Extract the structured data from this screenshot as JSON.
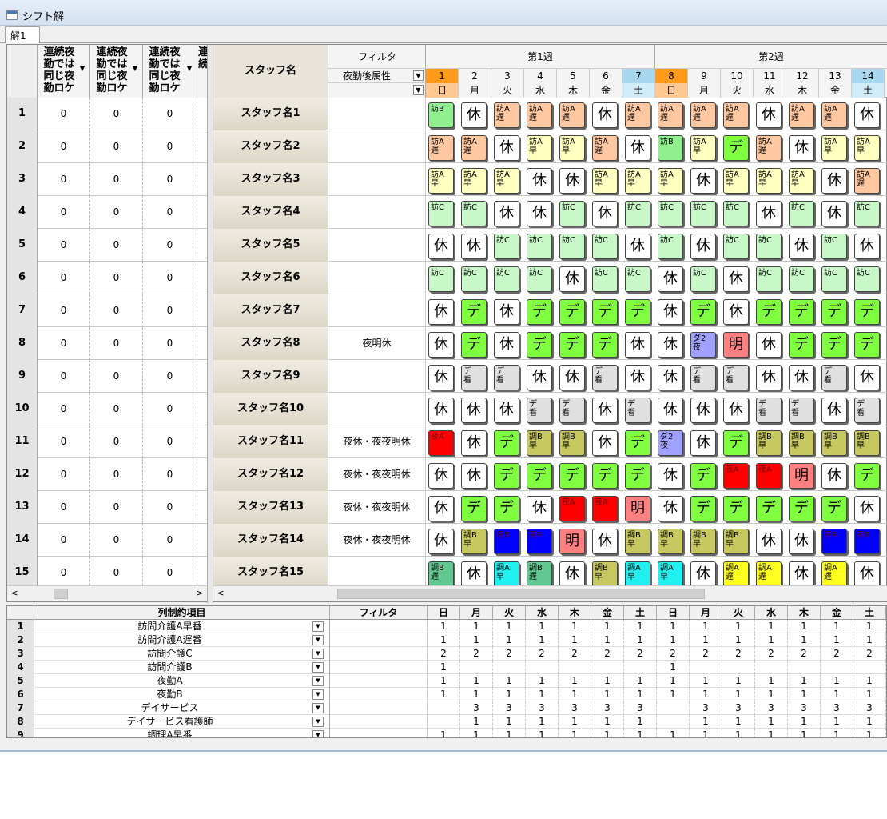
{
  "window": {
    "title": "シフト解",
    "tab": "解1"
  },
  "left_grid": {
    "headers": [
      "連続夜勤では同じ夜勤ロケ",
      "連続夜勤では同じ夜勤ロケ",
      "連続夜勤では同じ夜勤ロケ",
      "連続"
    ],
    "rows": [
      {
        "num": "1",
        "vals": [
          "0",
          "0",
          "0"
        ]
      },
      {
        "num": "2",
        "vals": [
          "0",
          "0",
          "0"
        ]
      },
      {
        "num": "3",
        "vals": [
          "0",
          "0",
          "0"
        ]
      },
      {
        "num": "4",
        "vals": [
          "0",
          "0",
          "0"
        ]
      },
      {
        "num": "5",
        "vals": [
          "0",
          "0",
          "0"
        ]
      },
      {
        "num": "6",
        "vals": [
          "0",
          "0",
          "0"
        ]
      },
      {
        "num": "7",
        "vals": [
          "0",
          "0",
          "0"
        ]
      },
      {
        "num": "8",
        "vals": [
          "0",
          "0",
          "0"
        ]
      },
      {
        "num": "9",
        "vals": [
          "0",
          "0",
          "0"
        ]
      },
      {
        "num": "10",
        "vals": [
          "0",
          "0",
          "0"
        ]
      },
      {
        "num": "11",
        "vals": [
          "0",
          "0",
          "0"
        ]
      },
      {
        "num": "12",
        "vals": [
          "0",
          "0",
          "0"
        ]
      },
      {
        "num": "13",
        "vals": [
          "0",
          "0",
          "0"
        ]
      },
      {
        "num": "14",
        "vals": [
          "0",
          "0",
          "0"
        ]
      },
      {
        "num": "15",
        "vals": [
          "0",
          "0",
          "0"
        ]
      }
    ]
  },
  "main_grid": {
    "staff_header": "スタッフ名",
    "filter_header": "フィルタ",
    "filter_attr": "夜勤後属性",
    "weeks": [
      "第1週",
      "第2週"
    ],
    "days": [
      {
        "n": "1",
        "w": "日",
        "bg": "#ff9a1a",
        "wbg": "#ffc890"
      },
      {
        "n": "2",
        "w": "月",
        "bg": "#f4f4f4",
        "wbg": "#f4f4f4"
      },
      {
        "n": "3",
        "w": "火",
        "bg": "#f4f4f4",
        "wbg": "#f4f4f4"
      },
      {
        "n": "4",
        "w": "水",
        "bg": "#f4f4f4",
        "wbg": "#f4f4f4"
      },
      {
        "n": "5",
        "w": "木",
        "bg": "#f4f4f4",
        "wbg": "#f4f4f4"
      },
      {
        "n": "6",
        "w": "金",
        "bg": "#f4f4f4",
        "wbg": "#f4f4f4"
      },
      {
        "n": "7",
        "w": "土",
        "bg": "#a8d8f0",
        "wbg": "#d0ecf8"
      },
      {
        "n": "8",
        "w": "日",
        "bg": "#ff9a1a",
        "wbg": "#ffc890"
      },
      {
        "n": "9",
        "w": "月",
        "bg": "#f4f4f4",
        "wbg": "#f4f4f4"
      },
      {
        "n": "10",
        "w": "火",
        "bg": "#f4f4f4",
        "wbg": "#f4f4f4"
      },
      {
        "n": "11",
        "w": "水",
        "bg": "#f4f4f4",
        "wbg": "#f4f4f4"
      },
      {
        "n": "12",
        "w": "木",
        "bg": "#f4f4f4",
        "wbg": "#f4f4f4"
      },
      {
        "n": "13",
        "w": "金",
        "bg": "#f4f4f4",
        "wbg": "#f4f4f4"
      },
      {
        "n": "14",
        "w": "土",
        "bg": "#a8d8f0",
        "wbg": "#d0ecf8"
      }
    ],
    "shift_types": {
      "休": {
        "label": "休",
        "bg": "#ffffff",
        "size": "big"
      },
      "デ": {
        "label": "デ",
        "bg": "#80ff40",
        "size": "big"
      },
      "明": {
        "label": "明",
        "bg": "#ff8080",
        "size": "big"
      },
      "訪B": {
        "label": "訪B",
        "bg": "#90f090",
        "size": "sm1"
      },
      "訪C": {
        "label": "訪C",
        "bg": "#c8f8c8",
        "size": "sm1"
      },
      "訪A遅": {
        "label": "訪A\n遅",
        "bg": "#ffc8a0",
        "size": "sm"
      },
      "訪A早": {
        "label": "訪A\n早",
        "bg": "#ffffc0",
        "size": "sm"
      },
      "デ看": {
        "label": "デ\n看",
        "bg": "#e0e0e0",
        "size": "sm"
      },
      "夜A": {
        "label": "夜A",
        "bg": "#ff0000",
        "size": "sm1"
      },
      "夜B": {
        "label": "夜B",
        "bg": "#0000ff",
        "size": "sm1"
      },
      "ダ2夜": {
        "label": "ダ2\n夜",
        "bg": "#a0a0ff",
        "size": "sm"
      },
      "調B早": {
        "label": "調B\n早",
        "bg": "#c8c860",
        "size": "sm"
      },
      "調B遅": {
        "label": "調B\n遅",
        "bg": "#60c890",
        "size": "sm"
      },
      "調A早": {
        "label": "調A\n早",
        "bg": "#20f0f0",
        "size": "sm"
      },
      "調A遅": {
        "label": "調A\n遅",
        "bg": "#ffff20",
        "size": "sm"
      }
    },
    "rows": [
      {
        "name": "スタッフ名1",
        "filter": "",
        "cells": [
          "訪B",
          "休",
          "訪A遅",
          "訪A遅",
          "訪A遅",
          "休",
          "訪A遅",
          "訪A遅",
          "訪A遅",
          "訪A遅",
          "休",
          "訪A遅",
          "訪A遅",
          "休"
        ]
      },
      {
        "name": "スタッフ名2",
        "filter": "",
        "cells": [
          "訪A遅",
          "訪A遅",
          "休",
          "訪A早",
          "訪A早",
          "訪A遅",
          "休",
          "訪B",
          "訪A早",
          "デ",
          "訪A遅",
          "休",
          "訪A早",
          "訪A早"
        ]
      },
      {
        "name": "スタッフ名3",
        "filter": "",
        "cells": [
          "訪A早",
          "訪A早",
          "訪A早",
          "休",
          "休",
          "訪A早",
          "訪A早",
          "訪A早",
          "休",
          "訪A早",
          "訪A早",
          "訪A早",
          "休",
          "訪A遅"
        ]
      },
      {
        "name": "スタッフ名4",
        "filter": "",
        "cells": [
          "訪C",
          "訪C",
          "休",
          "休",
          "訪C",
          "休",
          "訪C",
          "訪C",
          "訪C",
          "訪C",
          "休",
          "訪C",
          "休",
          "訪C"
        ]
      },
      {
        "name": "スタッフ名5",
        "filter": "",
        "cells": [
          "休",
          "休",
          "訪C",
          "訪C",
          "訪C",
          "訪C",
          "休",
          "訪C",
          "休",
          "訪C",
          "訪C",
          "休",
          "訪C",
          "休"
        ]
      },
      {
        "name": "スタッフ名6",
        "filter": "",
        "cells": [
          "訪C",
          "訪C",
          "訪C",
          "訪C",
          "休",
          "訪C",
          "訪C",
          "休",
          "訪C",
          "休",
          "訪C",
          "訪C",
          "訪C",
          "訪C"
        ]
      },
      {
        "name": "スタッフ名7",
        "filter": "",
        "cells": [
          "休",
          "デ",
          "休",
          "デ",
          "デ",
          "デ",
          "デ",
          "休",
          "デ",
          "休",
          "デ",
          "デ",
          "デ",
          "デ"
        ]
      },
      {
        "name": "スタッフ名8",
        "filter": "夜明休",
        "cells": [
          "休",
          "デ",
          "休",
          "デ",
          "デ",
          "デ",
          "休",
          "休",
          "ダ2夜",
          "明",
          "休",
          "デ",
          "デ",
          "デ"
        ]
      },
      {
        "name": "スタッフ名9",
        "filter": "",
        "cells": [
          "休",
          "デ看",
          "デ看",
          "休",
          "休",
          "デ看",
          "休",
          "休",
          "デ看",
          "デ看",
          "休",
          "休",
          "デ看",
          "休"
        ]
      },
      {
        "name": "スタッフ名10",
        "filter": "",
        "cells": [
          "休",
          "休",
          "休",
          "デ看",
          "デ看",
          "休",
          "デ看",
          "休",
          "休",
          "休",
          "デ看",
          "デ看",
          "休",
          "デ看"
        ]
      },
      {
        "name": "スタッフ名11",
        "filter": "夜休・夜夜明休",
        "cells": [
          "夜A",
          "休",
          "デ",
          "調B早",
          "調B早",
          "休",
          "デ",
          "ダ2夜",
          "休",
          "デ",
          "調B早",
          "調B早",
          "調B早",
          "調B早"
        ]
      },
      {
        "name": "スタッフ名12",
        "filter": "夜休・夜夜明休",
        "cells": [
          "休",
          "休",
          "デ",
          "デ",
          "デ",
          "デ",
          "デ",
          "休",
          "デ",
          "夜A",
          "夜A",
          "明",
          "休",
          "デ"
        ]
      },
      {
        "name": "スタッフ名13",
        "filter": "夜休・夜夜明休",
        "cells": [
          "休",
          "デ",
          "デ",
          "休",
          "夜A",
          "夜A",
          "明",
          "休",
          "デ",
          "デ",
          "デ",
          "デ",
          "デ",
          "休"
        ]
      },
      {
        "name": "スタッフ名14",
        "filter": "夜休・夜夜明休",
        "cells": [
          "休",
          "調B早",
          "夜B",
          "夜B",
          "明",
          "休",
          "調B早",
          "調B早",
          "調B早",
          "調B早",
          "休",
          "休",
          "夜B",
          "夜B"
        ]
      },
      {
        "name": "スタッフ名15",
        "filter": "",
        "cells": [
          "調B遅",
          "休",
          "調A早",
          "調B遅",
          "休",
          "調B早",
          "調A早",
          "調A早",
          "休",
          "調A遅",
          "調A遅",
          "休",
          "調A遅",
          "休"
        ]
      }
    ]
  },
  "constraints": {
    "header_item": "列制約項目",
    "header_filter": "フィルタ",
    "weekdays": [
      "日",
      "月",
      "火",
      "水",
      "木",
      "金",
      "土",
      "日",
      "月",
      "火",
      "水",
      "木",
      "金",
      "土"
    ],
    "rows": [
      {
        "num": "1",
        "name": "訪問介護A早番",
        "vals": [
          "1",
          "1",
          "1",
          "1",
          "1",
          "1",
          "1",
          "1",
          "1",
          "1",
          "1",
          "1",
          "1",
          "1"
        ]
      },
      {
        "num": "2",
        "name": "訪問介護A遅番",
        "vals": [
          "1",
          "1",
          "1",
          "1",
          "1",
          "1",
          "1",
          "1",
          "1",
          "1",
          "1",
          "1",
          "1",
          "1"
        ]
      },
      {
        "num": "3",
        "name": "訪問介護C",
        "vals": [
          "2",
          "2",
          "2",
          "2",
          "2",
          "2",
          "2",
          "2",
          "2",
          "2",
          "2",
          "2",
          "2",
          "2"
        ]
      },
      {
        "num": "4",
        "name": "訪問介護B",
        "vals": [
          "1",
          "",
          "",
          "",
          "",
          "",
          "",
          "1",
          "",
          "",
          "",
          "",
          "",
          ""
        ]
      },
      {
        "num": "5",
        "name": "夜勤A",
        "vals": [
          "1",
          "1",
          "1",
          "1",
          "1",
          "1",
          "1",
          "1",
          "1",
          "1",
          "1",
          "1",
          "1",
          "1"
        ]
      },
      {
        "num": "6",
        "name": "夜勤B",
        "vals": [
          "1",
          "1",
          "1",
          "1",
          "1",
          "1",
          "1",
          "1",
          "1",
          "1",
          "1",
          "1",
          "1",
          "1"
        ]
      },
      {
        "num": "7",
        "name": "デイサービス",
        "vals": [
          "",
          "3",
          "3",
          "3",
          "3",
          "3",
          "3",
          "",
          "3",
          "3",
          "3",
          "3",
          "3",
          "3"
        ]
      },
      {
        "num": "8",
        "name": "デイサービス看護師",
        "vals": [
          "",
          "1",
          "1",
          "1",
          "1",
          "1",
          "1",
          "",
          "1",
          "1",
          "1",
          "1",
          "1",
          "1"
        ]
      },
      {
        "num": "9",
        "name": "調理A早番",
        "vals": [
          "1",
          "1",
          "1",
          "1",
          "1",
          "1",
          "1",
          "1",
          "1",
          "1",
          "1",
          "1",
          "1",
          "1"
        ]
      }
    ]
  }
}
